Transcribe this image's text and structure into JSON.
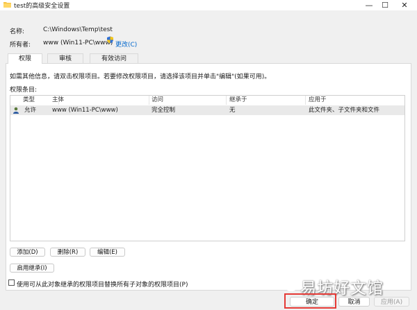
{
  "window": {
    "title": "test的高级安全设置",
    "minimize": "—",
    "maximize": "☐",
    "close": "✕"
  },
  "info": {
    "name_label": "名称:",
    "name_value": "C:\\Windows\\Temp\\test",
    "owner_label": "所有者:",
    "owner_value": "www (Win11-PC\\www)",
    "change_link": "更改(C)"
  },
  "tabs": [
    {
      "label": "权限",
      "active": true
    },
    {
      "label": "审核",
      "active": false
    },
    {
      "label": "有效访问",
      "active": false
    }
  ],
  "panel": {
    "instruction": "如需其他信息，请双击权限项目。若要修改权限项目，请选择该项目并单击\"编辑\"(如果可用)。",
    "entries_label": "权限条目:"
  },
  "table": {
    "columns": [
      "类型",
      "主体",
      "访问",
      "继承于",
      "应用于"
    ],
    "rows": [
      {
        "type": "允许",
        "principal": "www (Win11-PC\\www)",
        "access": "完全控制",
        "inherited": "无",
        "applies": "此文件夹、子文件夹和文件"
      }
    ]
  },
  "buttons": {
    "add": "添加(D)",
    "remove": "删除(R)",
    "edit": "编辑(E)",
    "enable_inheritance": "启用继承(I)",
    "replace_checkbox_label": "使用可从此对象继承的权限项目替换所有子对象的权限项目(P)",
    "ok": "确定",
    "cancel": "取消",
    "apply": "应用(A)"
  },
  "watermark": "易坊好文馆"
}
